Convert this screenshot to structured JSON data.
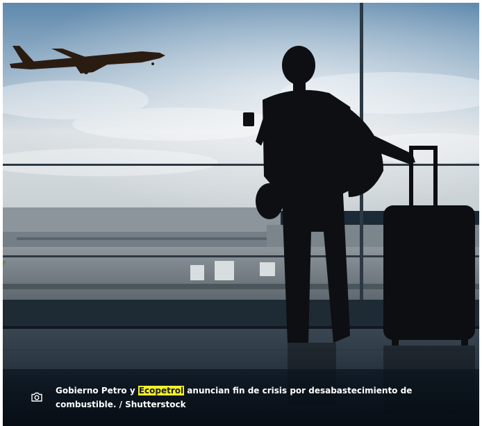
{
  "image": {
    "alt": "Silueta de viajero con maleta mirando un avión despegar desde la terminal"
  },
  "caption": {
    "icon": "camera-icon",
    "text_before": "Gobierno Petro y ",
    "highlight": "Ecopetrol",
    "text_after": " anuncian fin de crisis por desabastecimiento de combustible. / Shutterstock",
    "highlight_color": "#f4f22a"
  }
}
